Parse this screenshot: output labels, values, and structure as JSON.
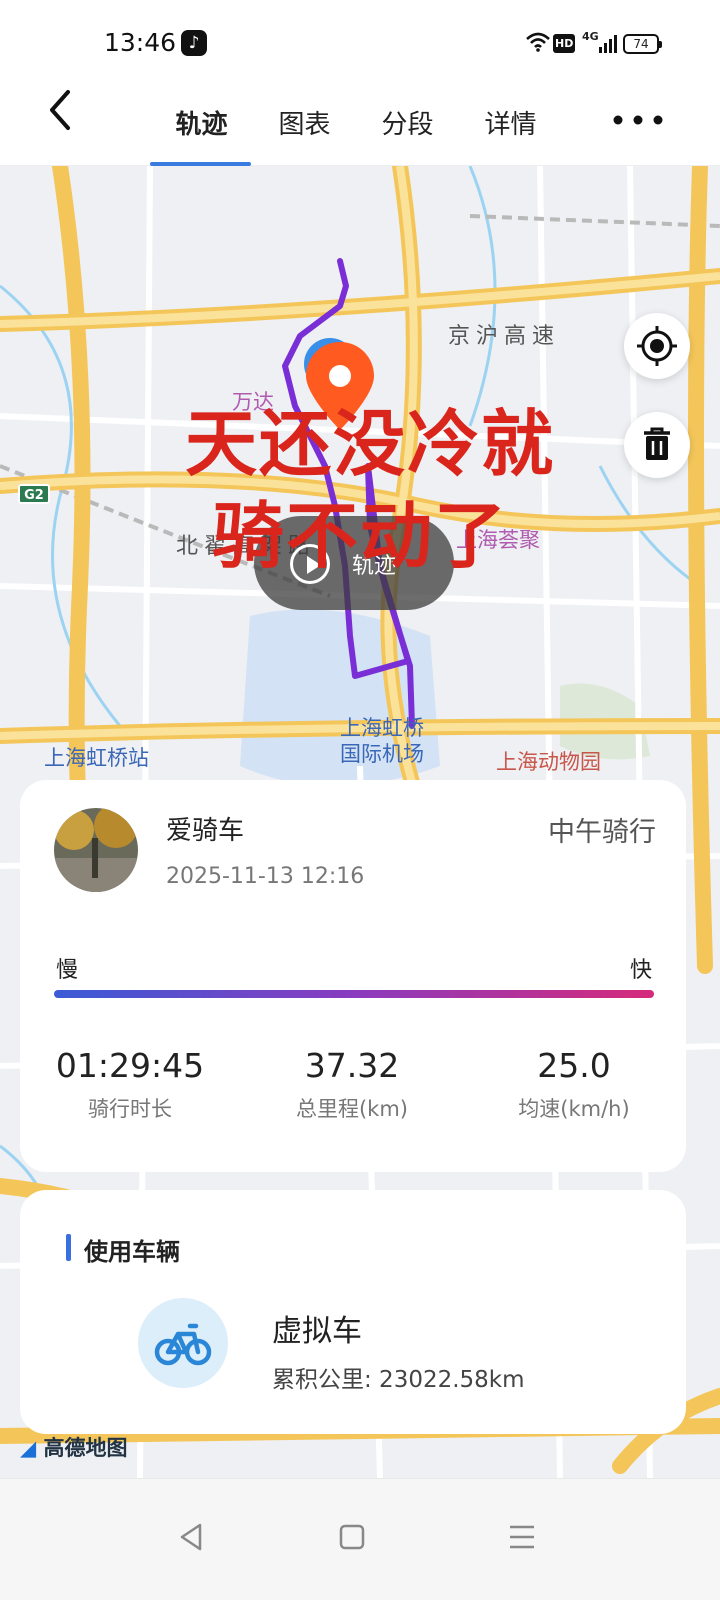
{
  "status_bar": {
    "time": "13:46",
    "app_icon": "tiktok-icon",
    "hd_badge": "HD",
    "network": "4G",
    "battery": "74"
  },
  "header": {
    "back_icon": "back-chevron-icon",
    "tabs": [
      {
        "label": "轨迹",
        "active": true
      },
      {
        "label": "图表",
        "active": false
      },
      {
        "label": "分段",
        "active": false
      },
      {
        "label": "详情",
        "active": false
      }
    ],
    "more_icon": "more-dots-icon"
  },
  "map": {
    "labels": {
      "road_jinghu": "京沪高速",
      "highway_sign": "G2",
      "wanda": "万达",
      "huijù": "上海荟聚",
      "beidi_road": "北翟高架路",
      "hongqiao_airport_line1": "上海虹桥",
      "hongqiao_airport_line2": "国际机场",
      "hongqiao_station": "上海虹桥站",
      "zoo": "上海动物园",
      "watermark": "高德地图"
    },
    "track_button_label": "轨迹",
    "overlay_text_line1": "天还没冷就",
    "overlay_text_line2": "骑不动了",
    "controls": [
      "locate-icon",
      "trash-icon"
    ],
    "track_color": "#7a2fd6",
    "pin_color": "#ff5a1f"
  },
  "ride_card": {
    "username": "爱骑车",
    "datetime": "2025-11-13 12:16",
    "ride_type": "中午骑行",
    "speed_scale": {
      "slow": "慢",
      "fast": "快"
    },
    "stats": [
      {
        "value": "01:29:45",
        "label": "骑行时长"
      },
      {
        "value": "37.32",
        "label": "总里程(km)"
      },
      {
        "value": "25.0",
        "label": "均速(km/h)"
      }
    ]
  },
  "vehicle_card": {
    "section_title": "使用车辆",
    "vehicle_name": "虚拟车",
    "cumulative_label": "累积公里: 23022.58km",
    "icon": "bicycle-icon"
  },
  "nav_bar": {
    "buttons": [
      "back-triangle-icon",
      "home-square-icon",
      "menu-lines-icon"
    ]
  }
}
